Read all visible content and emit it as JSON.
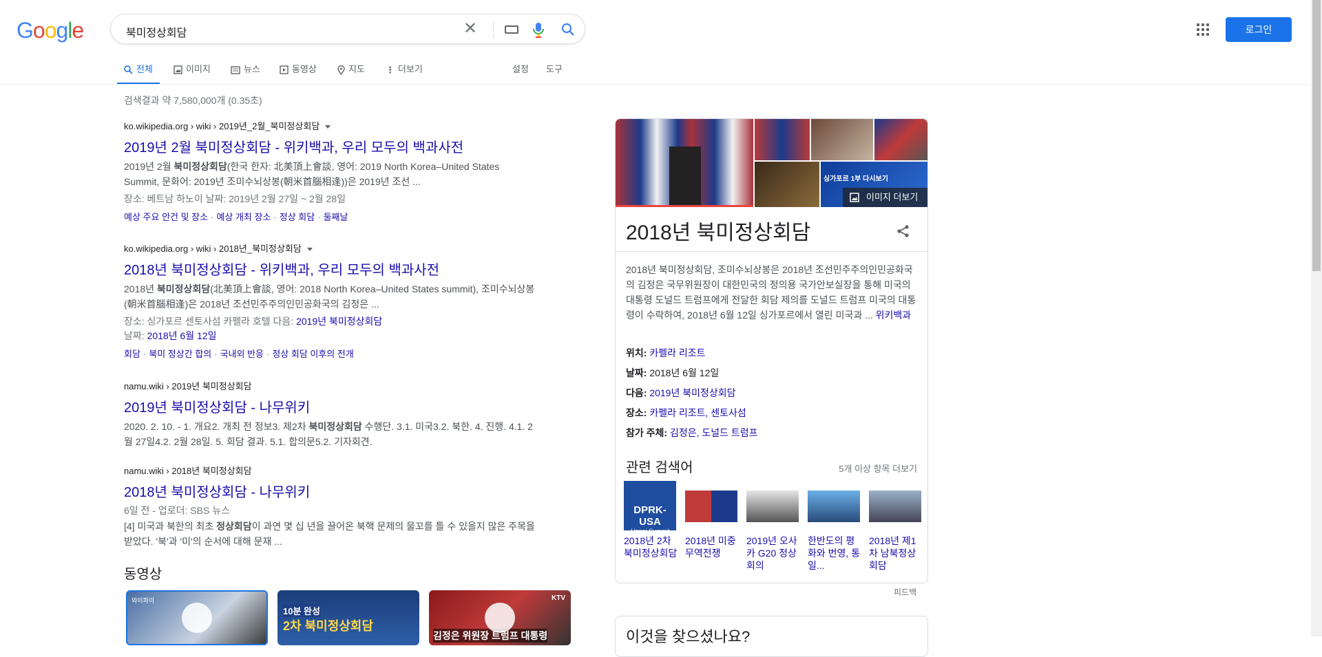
{
  "header": {
    "logo": "Google",
    "logo_colors": [
      "#4285F4",
      "#EA4335",
      "#FBBC05",
      "#4285F4",
      "#34A853",
      "#EA4335"
    ],
    "search_value": "북미정상회담",
    "login_label": "로그인"
  },
  "tabs": [
    {
      "label": "전체",
      "icon": "search-icon",
      "active": true
    },
    {
      "label": "이미지",
      "icon": "image-icon"
    },
    {
      "label": "뉴스",
      "icon": "news-icon"
    },
    {
      "label": "동영상",
      "icon": "video-icon"
    },
    {
      "label": "지도",
      "icon": "map-pin-icon"
    },
    {
      "label": "더보기",
      "icon": "more-vert-icon"
    }
  ],
  "tools": {
    "settings": "설정",
    "tools": "도구"
  },
  "stats": "검색결과 약 7,580,000개 (0.35초)",
  "results": [
    {
      "cite": "ko.wikipedia.org › wiki › 2019년_2월_북미정상회담",
      "title": "2019년 2월 북미정상회담 - 위키백과, 우리 모두의 백과사전",
      "snippet_html": "2019년 2월 <b>북미정상회담</b>(한국 한자: 北美頂上會談, 영어: 2019 North Korea–United States Summit, 문화어: 2019년 조미수뇌상봉(朝米首腦相逢))은 2019년 조선 ...",
      "meta1": "장소: 베트남 하노이    날짜: 2019년 2월 27일 ~ 2월 28일",
      "sitelinks": [
        "예상 주요 안건 및 장소",
        "예상 개최 장소",
        "정상 회담",
        "둘째날"
      ]
    },
    {
      "cite": "ko.wikipedia.org › wiki › 2018년_북미정상회담",
      "title": "2018년 북미정상회담 - 위키백과, 우리 모두의 백과사전",
      "snippet_html": "2018년 <b>북미정상회담</b>(北美頂上會談, 영어: 2018 North Korea–United States summit), 조미수뇌상봉(朝米首腦相逢)은 2018년 조선민주주의인민공화국의 김정은 ...",
      "meta1_prefix": "장소: 싱가포르 센토사섬 카펠라 호텔    다음: ",
      "meta1_link": "2019년 북미정상회담",
      "meta2_prefix": "날짜: ",
      "meta2_link": "2018년 6월 12일",
      "sitelinks": [
        "회담",
        "북미 정상간 합의",
        "국내외 반응",
        "정상 회담 이후의 전개"
      ]
    },
    {
      "cite": "namu.wiki › 2019년 북미정상회담",
      "title": "2019년 북미정상회담 - 나무위키",
      "snippet_html": "2020. 2. 10. - 1. 개요2. 개최 전 정보3. 제2차 <b>북미정상회담</b> 수행단. 3.1. 미국3.2. 북한. 4. 진행. 4.1. 2월 27일4.2. 2월 28일. 5. 회담 결과. 5.1. 합의문5.2. 기자회견."
    },
    {
      "cite": "namu.wiki › 2018년 북미정상회담",
      "title": "2018년 북미정상회담 - 나무위키",
      "meta1": "6일 전 - 업로더: SBS 뉴스",
      "snippet_html": "[4] 미국과 북한의 최초 <b>정상회담</b>이 과연 몇 십 년을 끌어온 북핵 문제의 물꼬를 틀 수 있을지 많은 주목을 받았다. '북'과 '미'의 순서에 대해 문재 ..."
    }
  ],
  "videos": {
    "heading": "동영상",
    "items": [
      {
        "badge": "와이파이"
      },
      {
        "overlay1": "10분 완성",
        "overlay2": "2차 북미정상회담"
      },
      {
        "badge": "KTV",
        "overlay2": "김정은 위원장 트럼프 대통령"
      }
    ]
  },
  "knowledge_panel": {
    "more_images": "이미지 더보기",
    "image_badge": "싱가포르 1부 다시보기",
    "title": "2018년 북미정상회담",
    "description": "2018년 북미정상회담, 조미수뇌상봉은 2018년 조선민주주의인민공화국의 김정은 국무위원장이 대한민국의 정의용 국가안보실장을 통해 미국의 대통령 도널드 트럼프에게 전달한 회담 제의를 도널드 트럼프 미국의 대통령이 수락하여, 2018년 6월 12일 싱가포르에서 열린 미국과 ...",
    "description_link": "위키백과",
    "facts": [
      {
        "label": "위치:",
        "value": "카펠라 리조트",
        "link": true
      },
      {
        "label": "날짜:",
        "value": "2018년 6월 12일",
        "link": false
      },
      {
        "label": "다음:",
        "value": "2019년 북미정상회담",
        "link": true
      },
      {
        "label": "장소:",
        "value": "카펠라 리조트, 센토사섬",
        "link": true
      },
      {
        "label": "참가 주체:",
        "value": "김정은, 도널드 트럼프",
        "link": true
      }
    ],
    "related_heading": "관련 검색어",
    "related_more": "5개 이상 항목 더보기",
    "related": [
      {
        "label": "2018년 2차 북미정상회담",
        "thumb_text": "DPRK-USA",
        "thumb_sub": "Hanoi Summit",
        "thumb_sub2": "VIET NAM"
      },
      {
        "label": "2018년 미중 무역전쟁"
      },
      {
        "label": "2019년 오사카 G20 정상회의"
      },
      {
        "label": "한반도의 평화와 번영, 통일..."
      },
      {
        "label": "2018년 제1차 남북정상회담"
      }
    ],
    "feedback": "피드백",
    "next_title": "이것을 찾으셨나요?"
  },
  "colors": {
    "link": "#1a0dab",
    "accent": "#1a73e8",
    "text_secondary": "#70757a"
  }
}
